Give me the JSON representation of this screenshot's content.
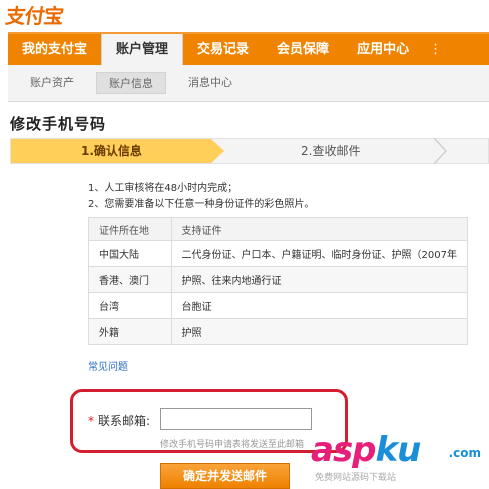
{
  "logo": {
    "text": "支付宝"
  },
  "topnav": {
    "items": [
      {
        "label": "我的支付宝"
      },
      {
        "label": "账户管理"
      },
      {
        "label": "交易记录"
      },
      {
        "label": "会员保障"
      },
      {
        "label": "应用中心"
      }
    ],
    "more": "⋮"
  },
  "subnav": {
    "items": [
      {
        "label": "账户资产"
      },
      {
        "label": "账户信息"
      },
      {
        "label": "消息中心"
      }
    ]
  },
  "page_title": "修改手机号码",
  "steps": {
    "step1": "1.确认信息",
    "step2": "2.查收邮件"
  },
  "notes": {
    "line1": "1、人工审核将在48小时内完成；",
    "line2": "2、您需要准备以下任意一种身份证件的彩色照片。"
  },
  "cert_table": {
    "headers": [
      "证件所在地",
      "支持证件"
    ],
    "rows": [
      [
        "中国大陆",
        "二代身份证、户口本、户籍证明、临时身份证、护照（2007年"
      ],
      [
        "香港、澳门",
        "护照、往来内地通行证"
      ],
      [
        "台湾",
        "台胞证"
      ],
      [
        "外籍",
        "护照"
      ]
    ]
  },
  "faq_link": "常见问题",
  "email": {
    "required_mark": "*",
    "label": "联系邮箱:",
    "value": "",
    "hint": "修改手机号码申请表将发送至此邮箱"
  },
  "submit_label": "确定并发送邮件",
  "watermark": {
    "main_a": "asp",
    "main_b": "ku",
    "com": ".com",
    "sub": "免费网站源码下载站"
  },
  "colors": {
    "brand_orange": "#f08300",
    "step_active": "#ffcf5a",
    "highlight_red": "#d21e2e",
    "link_blue": "#2b6dc4"
  }
}
